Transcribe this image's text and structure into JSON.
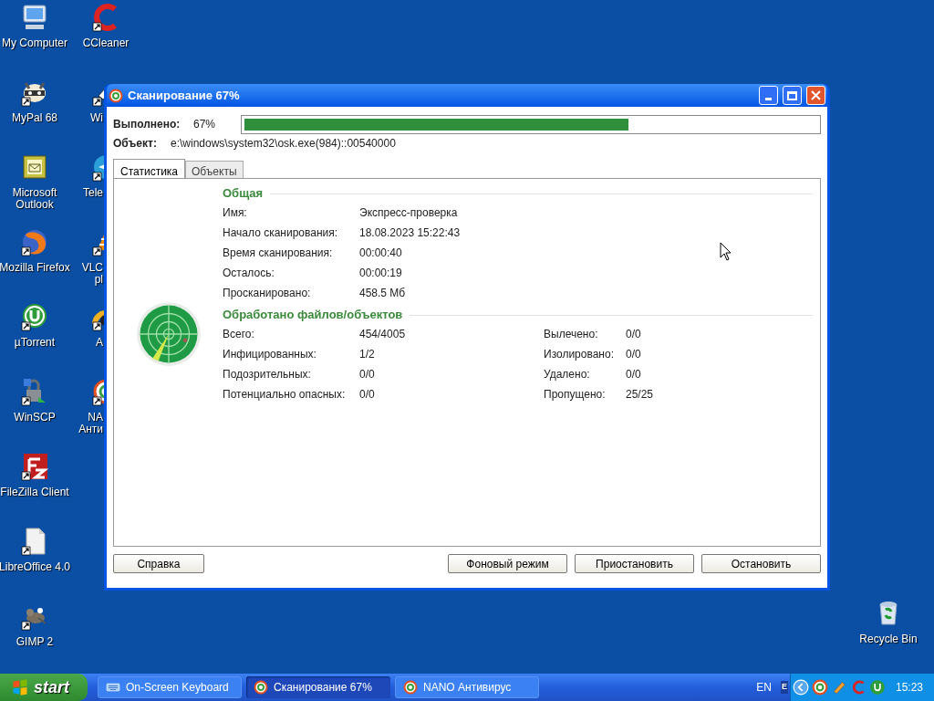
{
  "desktop": {
    "column_1": [
      {
        "label": "My Computer"
      },
      {
        "label": "MyPal 68"
      },
      {
        "label": "Microsoft\nOutlook"
      },
      {
        "label": "Mozilla Firefox"
      },
      {
        "label": "µTorrent"
      },
      {
        "label": "WinSCP"
      },
      {
        "label": "FileZilla Client"
      },
      {
        "label": "LibreOffice 4.0"
      },
      {
        "label": "GIMP 2"
      }
    ],
    "column_2": [
      {
        "label": "CCleaner"
      },
      {
        "label": "Wi"
      },
      {
        "label": "Tele"
      },
      {
        "label": "VLC\npl"
      },
      {
        "label": "A"
      },
      {
        "label": "NA\nАнти"
      }
    ],
    "recycle_bin": {
      "label": "Recycle Bin"
    }
  },
  "window": {
    "title": "Сканирование 67%",
    "progress": {
      "label": "Выполнено:",
      "reading": "67%",
      "level": 0.67
    },
    "object": {
      "label": "Объект:",
      "value": "e:\\windows\\system32\\osk.exe(984)::00540000"
    },
    "tabs": [
      {
        "label": "Статистика",
        "selected": true
      },
      {
        "label": "Объекты",
        "selected": false
      }
    ],
    "general": {
      "heading": "Общая",
      "rows": [
        {
          "label": "Имя:",
          "value": "Экспресс-проверка"
        },
        {
          "label": "Начало сканирования:",
          "value": "18.08.2023 15:22:43"
        },
        {
          "label": "Время сканирования:",
          "value": "00:00:40"
        },
        {
          "label": "Осталось:",
          "value": "00:00:19"
        },
        {
          "label": "Просканировано:",
          "value": "458.5 Мб"
        }
      ]
    },
    "processed": {
      "heading": "Обработано файлов/объектов",
      "left": [
        {
          "label": "Всего:",
          "value": "454/4005"
        },
        {
          "label": "Инфицированных:",
          "value": "1/2"
        },
        {
          "label": "Подозрительных:",
          "value": "0/0"
        },
        {
          "label": "Потенциально опасных:",
          "value": "0/0"
        }
      ],
      "right": [
        {
          "label": "Вылечено:",
          "value": "0/0"
        },
        {
          "label": "Изолировано:",
          "value": "0/0"
        },
        {
          "label": "Удалено:",
          "value": "0/0"
        },
        {
          "label": "Пропущено:",
          "value": "25/25"
        }
      ]
    },
    "buttons_left": [
      "Справка"
    ],
    "buttons_right": [
      "Фоновый режим",
      "Приостановить",
      "Остановить"
    ]
  },
  "taskbar": {
    "start": "start",
    "tasks": [
      {
        "label": "On-Screen Keyboard",
        "selected": false
      },
      {
        "label": "Сканирование 67%",
        "selected": true
      },
      {
        "label": "NANO Антивирус",
        "selected": false
      }
    ],
    "language": "EN",
    "tray_letter": "E",
    "clock": "15:23"
  }
}
